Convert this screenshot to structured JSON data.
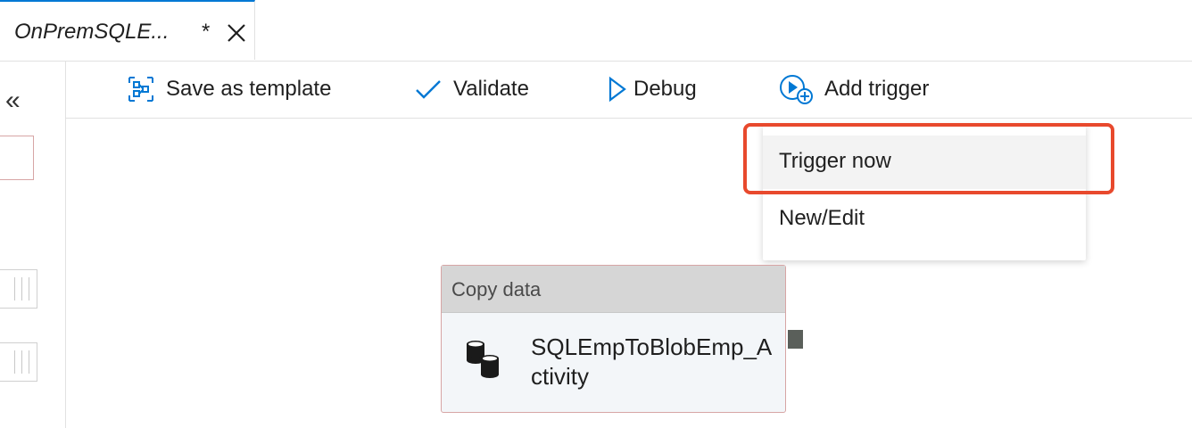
{
  "tab": {
    "title": "OnPremSQLE...",
    "dirty_marker": "*"
  },
  "leftrail": {
    "collapse_glyph": "«"
  },
  "toolbar": {
    "save_template": "Save as template",
    "validate": "Validate",
    "debug": "Debug",
    "add_trigger": "Add trigger"
  },
  "trigger_menu": {
    "items": [
      {
        "label": "Trigger now",
        "highlighted": true
      },
      {
        "label": "New/Edit",
        "highlighted": false
      }
    ]
  },
  "activity": {
    "type": "Copy data",
    "name": "SQLEmpToBlobEmp_Activity"
  },
  "colors": {
    "accent": "#0078d4",
    "highlight": "#e8492d",
    "activity_header": "#d6d6d6"
  }
}
